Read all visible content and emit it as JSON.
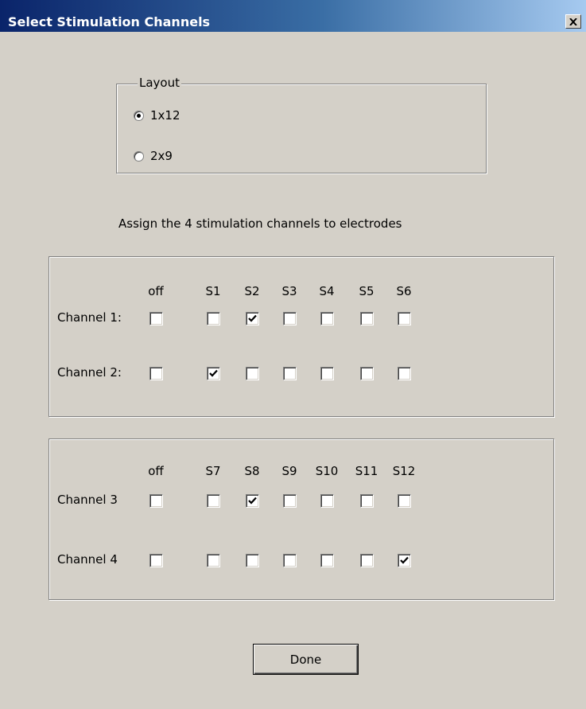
{
  "window": {
    "title": "Select Stimulation Channels"
  },
  "layout_group": {
    "legend": "Layout",
    "options": [
      {
        "label": "1x12",
        "selected": true
      },
      {
        "label": "2x9",
        "selected": false
      }
    ]
  },
  "instruction": "Assign the 4 stimulation channels to electrodes",
  "group1": {
    "headers": [
      "off",
      "S1",
      "S2",
      "S3",
      "S4",
      "S5",
      "S6"
    ],
    "rows": [
      {
        "label": "Channel 1:",
        "checked": [
          false,
          false,
          true,
          false,
          false,
          false,
          false
        ]
      },
      {
        "label": "Channel 2:",
        "checked": [
          false,
          true,
          false,
          false,
          false,
          false,
          false
        ]
      }
    ]
  },
  "group2": {
    "headers": [
      "off",
      "S7",
      "S8",
      "S9",
      "S10",
      "S11",
      "S12"
    ],
    "rows": [
      {
        "label": "Channel 3",
        "checked": [
          false,
          false,
          true,
          false,
          false,
          false,
          false
        ]
      },
      {
        "label": "Channel 4",
        "checked": [
          false,
          false,
          false,
          false,
          false,
          false,
          true
        ]
      }
    ]
  },
  "done_button": "Done",
  "icons": {
    "close": "close-icon",
    "check": "check-icon"
  },
  "colors": {
    "titlebar_start": "#0a246a",
    "titlebar_end": "#a6caf0",
    "face": "#d4d0c8"
  }
}
